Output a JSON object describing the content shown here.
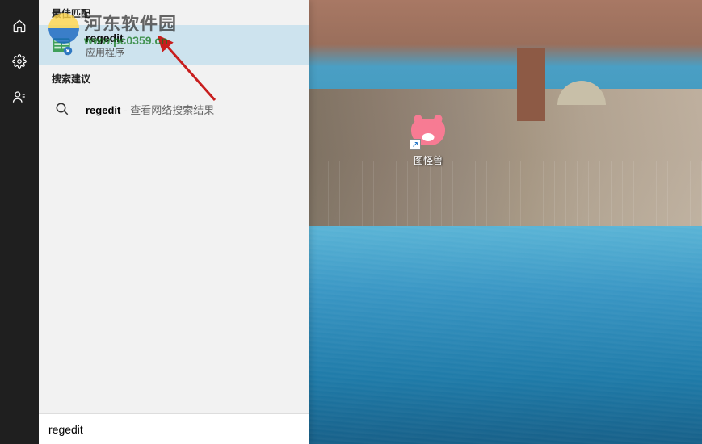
{
  "watermark": {
    "title": "河东软件园",
    "url": "www.pc0359.cn"
  },
  "sidebar": {
    "items": [
      {
        "name": "home-icon",
        "label": "Home"
      },
      {
        "name": "gear-icon",
        "label": "Settings"
      },
      {
        "name": "user-icon",
        "label": "User"
      }
    ]
  },
  "search": {
    "query": "regedit",
    "sections": {
      "best_match": "最佳匹配",
      "suggestions": "搜索建议"
    },
    "best_match": {
      "title": "regedit",
      "subtitle": "应用程序"
    },
    "web_suggest": {
      "term": "regedit",
      "desc": "- 查看网络搜索结果"
    }
  },
  "desktop": {
    "shortcut": {
      "label": "图怪兽",
      "arrow": "↗"
    }
  },
  "annotation": {
    "arrow_color": "#c81e1e"
  }
}
